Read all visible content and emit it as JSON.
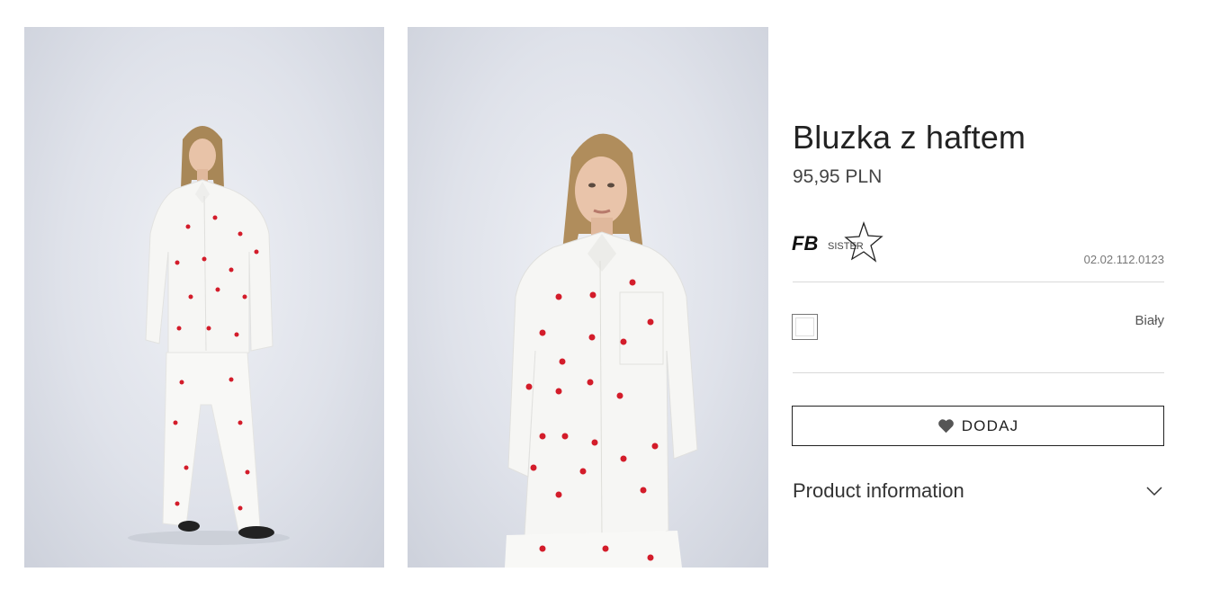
{
  "gallery": {
    "images": [
      {
        "alt": "Bluzka z haftem"
      },
      {
        "alt": "Bluzka z haftem"
      }
    ]
  },
  "product": {
    "title": "Bluzka z haftem",
    "price": "95,95 PLN",
    "brand_logo_text": "FB SISTER",
    "sku": "02.02.112.0123",
    "color_name": "Biały",
    "add_label": "DODAJ",
    "info_label": "Product information"
  },
  "colors": {
    "background": "#ffffff",
    "text": "#222222",
    "heart_accent": "#d31c2a",
    "heart_icon": "#555555",
    "divider": "#d9d9d9"
  },
  "icons": {
    "wishlist": "heart-icon",
    "expand": "chevron-down-icon",
    "brand_star": "star-icon"
  }
}
